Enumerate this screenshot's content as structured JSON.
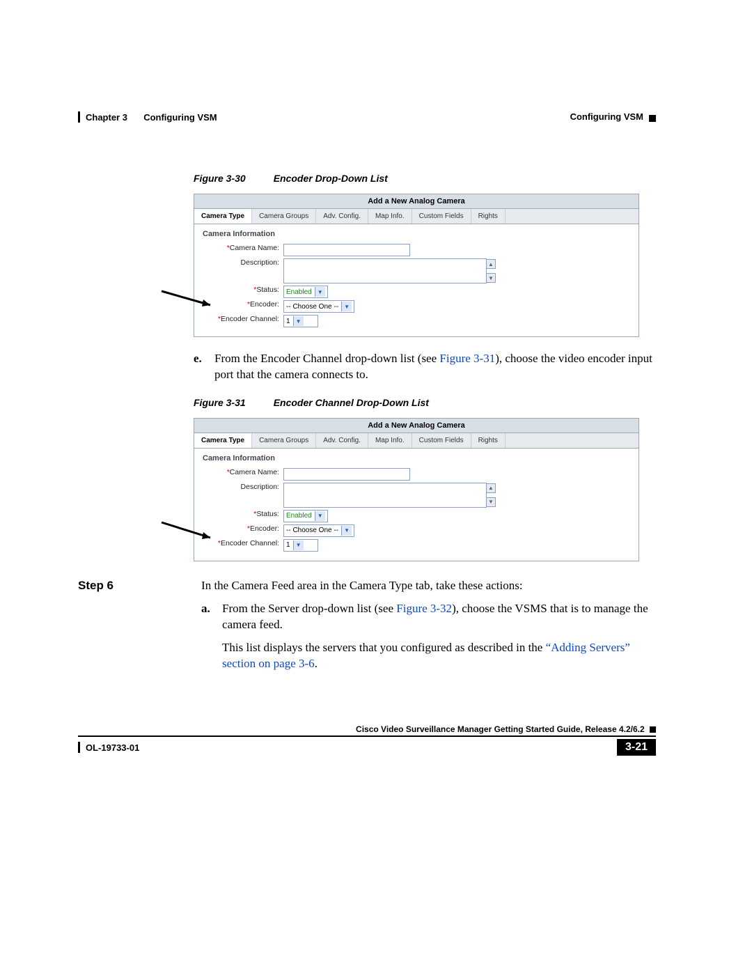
{
  "header": {
    "chapter": "Chapter 3",
    "title": "Configuring VSM",
    "right": "Configuring VSM"
  },
  "fig30": {
    "label": "Figure 3-30",
    "title": "Encoder Drop-Down List"
  },
  "fig31": {
    "label": "Figure 3-31",
    "title": "Encoder Channel Drop-Down List"
  },
  "dialog": {
    "title": "Add a New Analog Camera",
    "tabs": {
      "t0": "Camera Type",
      "t1": "Camera Groups",
      "t2": "Adv. Config.",
      "t3": "Map Info.",
      "t4": "Custom Fields",
      "t5": "Rights"
    },
    "section": "Camera Information",
    "labels": {
      "name": "Camera Name:",
      "desc": "Description:",
      "status": "Status:",
      "encoder": "Encoder:",
      "channel": "Encoder Channel:"
    },
    "values": {
      "status": "Enabled",
      "encoder": "-- Choose One --",
      "channel": "1"
    }
  },
  "step_e": {
    "marker": "e.",
    "text_a": "From the Encoder Channel drop-down list (see ",
    "xref": "Figure 3-31",
    "text_b": "), choose the video encoder input port that the camera connects to."
  },
  "step6": {
    "label": "Step 6",
    "intro": "In the Camera Feed area in the Camera Type tab, take these actions:",
    "a_marker": "a.",
    "a_text_a": "From the Server drop-down list (see ",
    "a_xref": "Figure 3-32",
    "a_text_b": "), choose the VSMS that is to manage the camera feed.",
    "para2_a": "This list displays the servers that you configured as described in the ",
    "para2_xref": "“Adding Servers” section on page 3-6",
    "para2_b": "."
  },
  "footer": {
    "doc_title": "Cisco Video Surveillance Manager Getting Started Guide, Release 4.2/6.2",
    "doc_id": "OL-19733-01",
    "page": "3-21"
  }
}
